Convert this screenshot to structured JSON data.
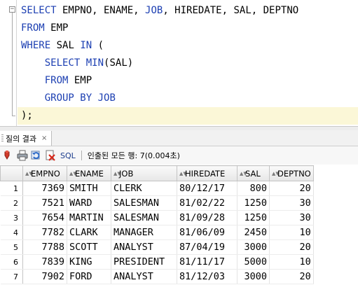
{
  "editor": {
    "lines": [
      [
        {
          "t": "SELECT",
          "k": true
        },
        {
          "t": " EMPNO, ENAME, ",
          "k": false
        },
        {
          "t": "JOB",
          "k": true
        },
        {
          "t": ", HIREDATE, SAL, DEPTNO",
          "k": false
        }
      ],
      [
        {
          "t": "FROM",
          "k": true
        },
        {
          "t": " EMP",
          "k": false
        }
      ],
      [
        {
          "t": "WHERE",
          "k": true
        },
        {
          "t": " SAL ",
          "k": false
        },
        {
          "t": "IN",
          "k": true
        },
        {
          "t": " (",
          "k": false
        }
      ],
      [
        {
          "t": "    ",
          "k": false
        },
        {
          "t": "SELECT",
          "k": true
        },
        {
          "t": " ",
          "k": false
        },
        {
          "t": "MIN",
          "k": true
        },
        {
          "t": "(SAL)",
          "k": false
        }
      ],
      [
        {
          "t": "    ",
          "k": false
        },
        {
          "t": "FROM",
          "k": true
        },
        {
          "t": " EMP",
          "k": false
        }
      ],
      [
        {
          "t": "    ",
          "k": false
        },
        {
          "t": "GROUP BY",
          "k": true
        },
        {
          "t": " ",
          "k": false
        },
        {
          "t": "JOB",
          "k": true
        }
      ],
      [
        {
          "t": ");",
          "k": false
        }
      ]
    ],
    "current_line": 6,
    "keyword_color": "#1c3fb2",
    "fold_symbol": "−"
  },
  "result_tab": {
    "label": "질의 결과",
    "close": "×"
  },
  "toolbar": {
    "icons": [
      "pin-icon",
      "print-icon",
      "refresh-icon",
      "export-icon"
    ],
    "sql_label": "SQL",
    "status": "인출된 모든 행: 7(0.004초)"
  },
  "grid": {
    "sort_glyph": "▲▼",
    "columns": [
      "EMPNO",
      "ENAME",
      "JOB",
      "HIREDATE",
      "SAL",
      "DEPTNO"
    ],
    "rows": [
      [
        "1",
        "7369",
        "SMITH",
        "CLERK",
        "80/12/17",
        "800",
        "20"
      ],
      [
        "2",
        "7521",
        "WARD",
        "SALESMAN",
        "81/02/22",
        "1250",
        "30"
      ],
      [
        "3",
        "7654",
        "MARTIN",
        "SALESMAN",
        "81/09/28",
        "1250",
        "30"
      ],
      [
        "4",
        "7782",
        "CLARK",
        "MANAGER",
        "81/06/09",
        "2450",
        "10"
      ],
      [
        "5",
        "7788",
        "SCOTT",
        "ANALYST",
        "87/04/19",
        "3000",
        "20"
      ],
      [
        "6",
        "7839",
        "KING",
        "PRESIDENT",
        "81/11/17",
        "5000",
        "10"
      ],
      [
        "7",
        "7902",
        "FORD",
        "ANALYST",
        "81/12/03",
        "3000",
        "20"
      ]
    ]
  }
}
